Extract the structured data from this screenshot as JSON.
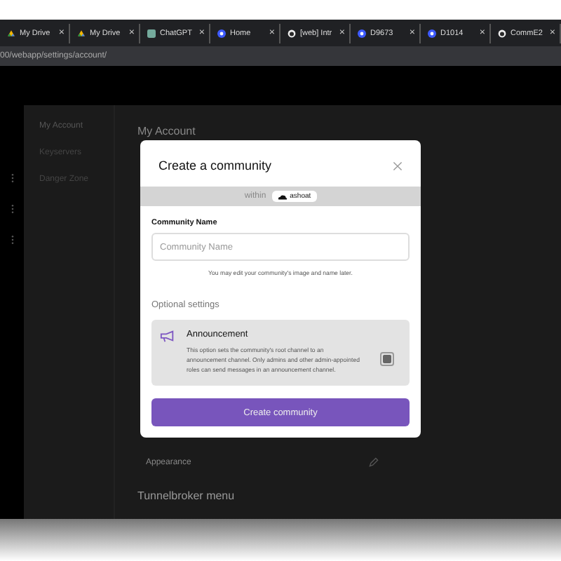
{
  "browser": {
    "tabs": [
      {
        "label": "My Drive",
        "selected": false
      },
      {
        "label": "My Drive",
        "selected": false
      },
      {
        "label": "ChatGPT",
        "selected": false
      },
      {
        "label": "Home",
        "selected": false
      },
      {
        "label": "[web] Intr",
        "selected": false
      },
      {
        "label": "D9673",
        "selected": false
      },
      {
        "label": "D1014",
        "selected": false
      },
      {
        "label": "CommE2",
        "selected": false
      }
    ],
    "close_glyph": "×",
    "address": "00/webapp/settings/account/"
  },
  "sidebar": {
    "items": [
      {
        "label": "My Account",
        "selected": true
      },
      {
        "label": "Keyservers",
        "selected": false
      },
      {
        "label": "Danger Zone",
        "selected": false
      }
    ]
  },
  "main": {
    "heading": "My Account",
    "row_label": "Appearance",
    "section_heading": "Tunnelbroker menu"
  },
  "modal": {
    "title": "Create a community",
    "within_label": "within",
    "within_chip": "ashoat",
    "name_label": "Community Name",
    "name_placeholder": "Community Name",
    "name_hint": "You may edit your community's image and name later.",
    "optional_heading": "Optional settings",
    "option": {
      "title": "Announcement",
      "description": "This option sets the community's root channel to an announcement channel. Only admins and other admin-appointed roles can send messages in an announcement channel.",
      "checked": true
    },
    "submit": "Create community"
  }
}
